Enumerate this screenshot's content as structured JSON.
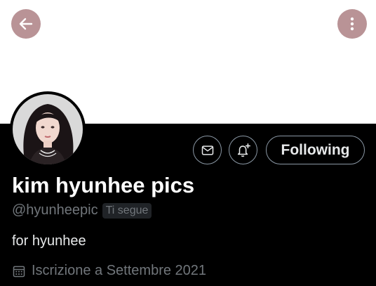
{
  "header": {
    "back_icon": "arrow-left-icon",
    "more_icon": "more-vertical-icon",
    "button_color": "#b99396",
    "banner_color": "#ffffff"
  },
  "actions": {
    "message_icon": "mail-icon",
    "notify_icon": "bell-plus-icon",
    "following_label": "Following"
  },
  "profile": {
    "display_name": "kim hyunhee pics",
    "handle": "@hyunheepic",
    "follows_you_badge": "Ti segue",
    "bio": "for hyunhee",
    "joined_icon": "calendar-icon",
    "joined": "Iscrizione a Settembre 2021"
  },
  "theme": {
    "background": "#000000",
    "primary_text": "#e7e9ea",
    "secondary_text": "#71767b",
    "border": "#8b98a5"
  }
}
